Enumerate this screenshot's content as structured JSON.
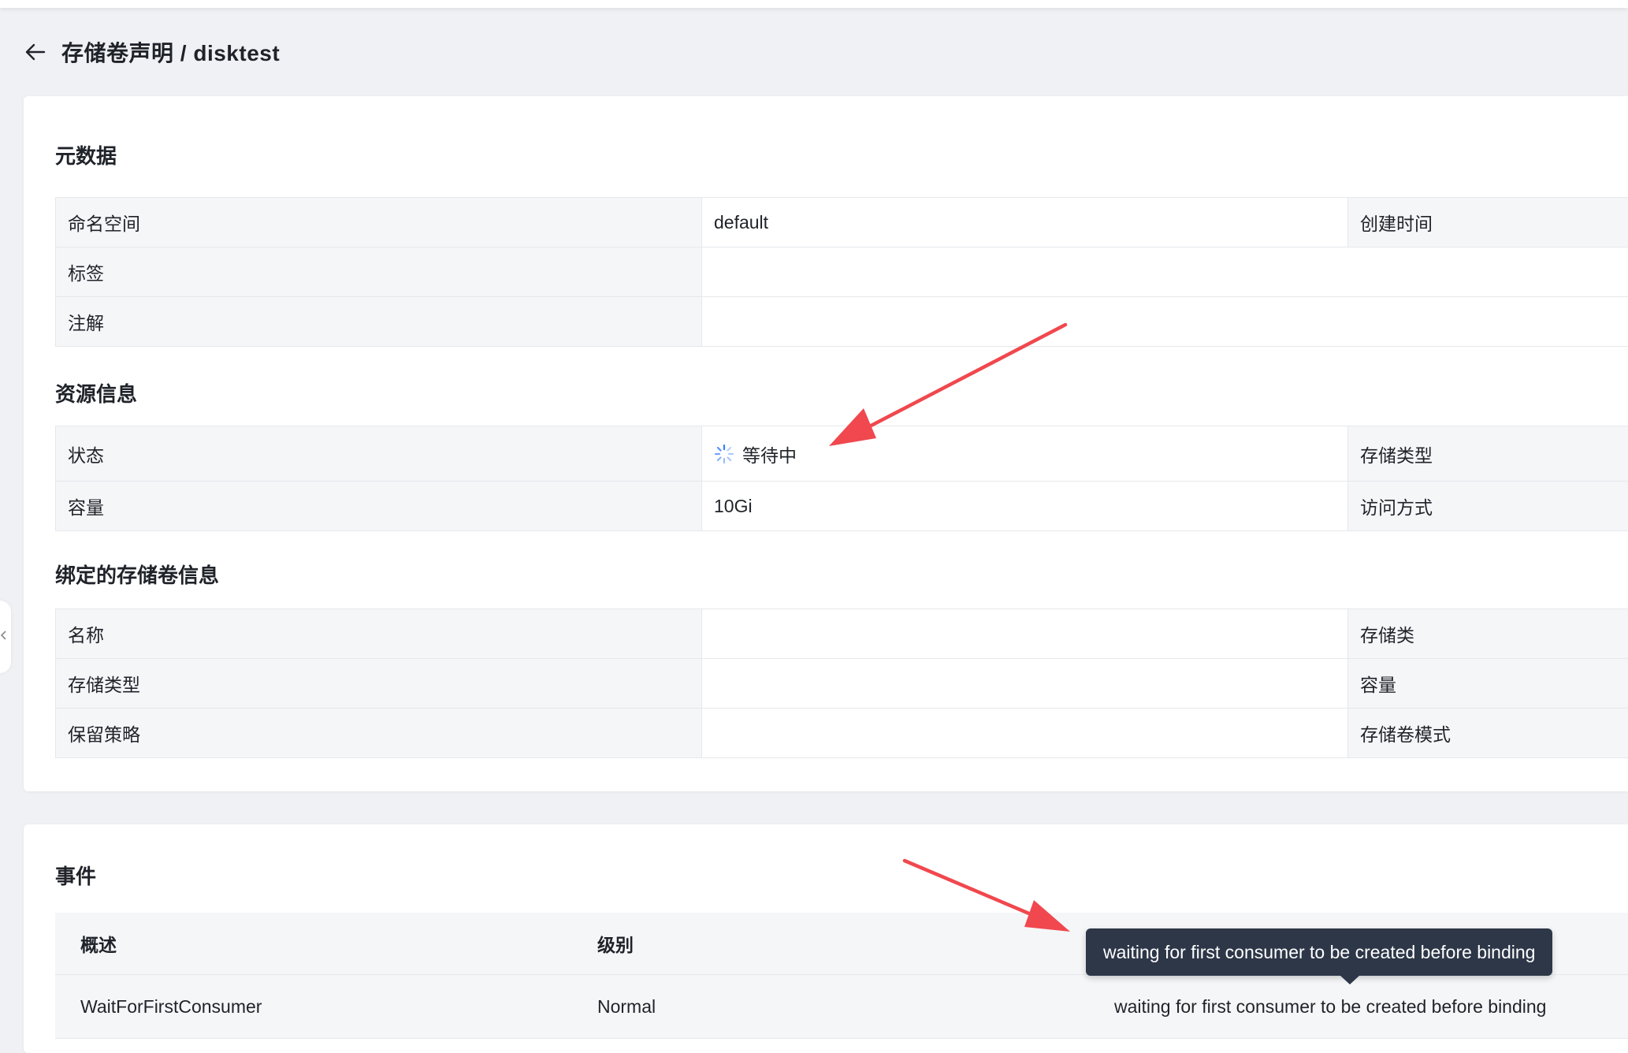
{
  "header": {
    "title": "存储卷声明 / disktest",
    "back_icon": "arrow-left-icon"
  },
  "metadata": {
    "section_title": "元数据",
    "rows": [
      {
        "label": "命名空间",
        "value": "default",
        "label2": "创建时间"
      },
      {
        "label": "标签",
        "value": ""
      },
      {
        "label": "注解",
        "value": ""
      }
    ]
  },
  "resource": {
    "section_title": "资源信息",
    "rows": [
      {
        "label": "状态",
        "value": "等待中",
        "label2": "存储类型"
      },
      {
        "label": "容量",
        "value": "10Gi",
        "label2": "访问方式"
      }
    ],
    "status_icon": "loading-spinner-icon",
    "status_color": "#3b7cff"
  },
  "bound": {
    "section_title": "绑定的存储卷信息",
    "rows": [
      {
        "label": "名称",
        "value": "",
        "label2": "存储类"
      },
      {
        "label": "存储类型",
        "value": "",
        "label2": "容量"
      },
      {
        "label": "保留策略",
        "value": "",
        "label2": "存储卷模式"
      }
    ]
  },
  "events": {
    "section_title": "事件",
    "columns": [
      "概述",
      "级别",
      ""
    ],
    "rows": [
      {
        "summary": "WaitForFirstConsumer",
        "level": "Normal",
        "message": "waiting for first consumer to be created before binding"
      }
    ],
    "tooltip": "waiting for first consumer to be created before binding"
  },
  "colors": {
    "background": "#f0f1f4",
    "card": "#ffffff",
    "label_cell": "#f5f6f8",
    "border": "#e6e8eb",
    "annotation_arrow": "#f0484e",
    "tooltip_bg": "#2d3748"
  }
}
